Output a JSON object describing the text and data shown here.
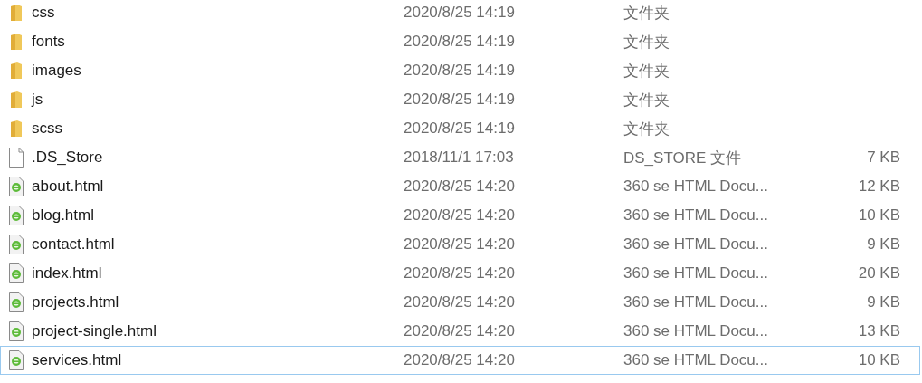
{
  "files": [
    {
      "kind": "folder",
      "name": "css",
      "modified": "2020/8/25 14:19",
      "type": "文件夹",
      "focused": false
    },
    {
      "kind": "folder",
      "name": "fonts",
      "modified": "2020/8/25 14:19",
      "type": "文件夹",
      "focused": false
    },
    {
      "kind": "folder",
      "name": "images",
      "modified": "2020/8/25 14:19",
      "type": "文件夹",
      "focused": false
    },
    {
      "kind": "folder",
      "name": "js",
      "modified": "2020/8/25 14:19",
      "type": "文件夹",
      "focused": false
    },
    {
      "kind": "folder",
      "name": "scss",
      "modified": "2020/8/25 14:19",
      "type": "文件夹",
      "focused": false
    },
    {
      "kind": "file",
      "name": ".DS_Store",
      "modified": "2018/11/1 17:03",
      "type": "DS_STORE 文件",
      "size": "7 KB",
      "focused": false
    },
    {
      "kind": "html",
      "name": "about.html",
      "modified": "2020/8/25 14:20",
      "type": "360 se HTML Docu...",
      "size": "12 KB",
      "focused": false
    },
    {
      "kind": "html",
      "name": "blog.html",
      "modified": "2020/8/25 14:20",
      "type": "360 se HTML Docu...",
      "size": "10 KB",
      "focused": false
    },
    {
      "kind": "html",
      "name": "contact.html",
      "modified": "2020/8/25 14:20",
      "type": "360 se HTML Docu...",
      "size": "9 KB",
      "focused": false
    },
    {
      "kind": "html",
      "name": "index.html",
      "modified": "2020/8/25 14:20",
      "type": "360 se HTML Docu...",
      "size": "20 KB",
      "focused": false
    },
    {
      "kind": "html",
      "name": "projects.html",
      "modified": "2020/8/25 14:20",
      "type": "360 se HTML Docu...",
      "size": "9 KB",
      "focused": false
    },
    {
      "kind": "html",
      "name": "project-single.html",
      "modified": "2020/8/25 14:20",
      "type": "360 se HTML Docu...",
      "size": "13 KB",
      "focused": false
    },
    {
      "kind": "html",
      "name": "services.html",
      "modified": "2020/8/25 14:20",
      "type": "360 se HTML Docu...",
      "size": "10 KB",
      "focused": true
    }
  ]
}
